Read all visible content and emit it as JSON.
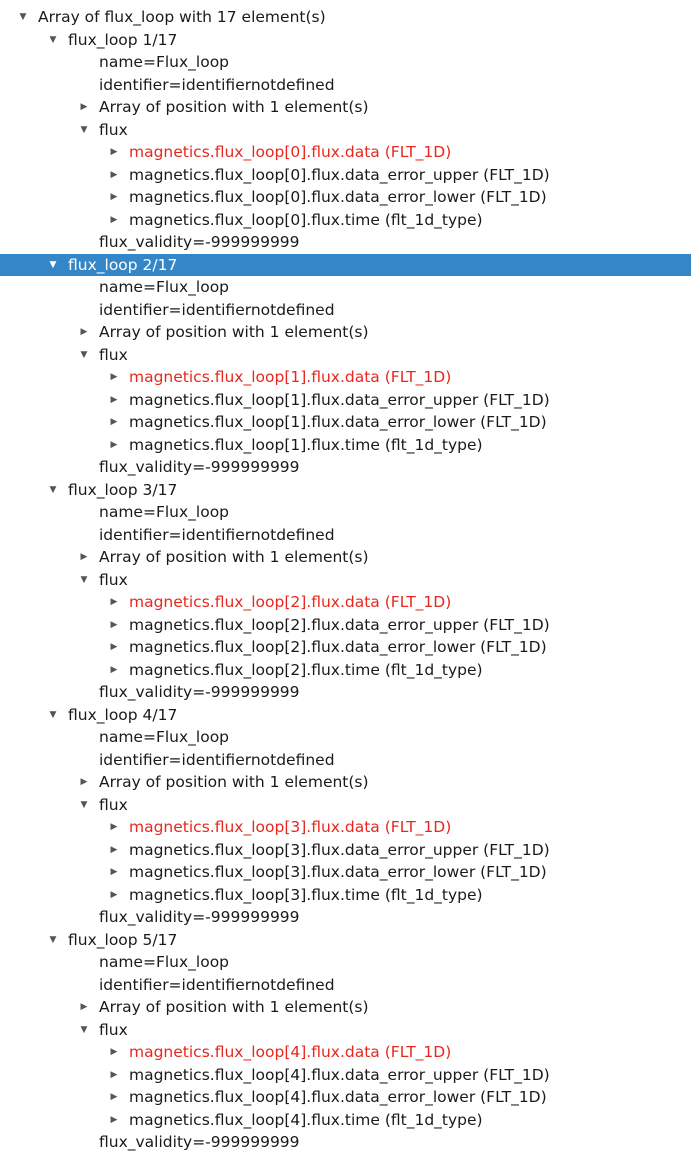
{
  "tree": {
    "root_label": "Array of flux_loop with 17 element(s)",
    "loops": [
      {
        "label": "flux_loop 1/17",
        "name": "name=Flux_loop",
        "identifier": "identifier=identifiernotdefined",
        "position": "Array of position with 1 element(s)",
        "flux_label": "flux",
        "data": "magnetics.flux_loop[0].flux.data (FLT_1D)",
        "data_error_upper": "magnetics.flux_loop[0].flux.data_error_upper (FLT_1D)",
        "data_error_lower": "magnetics.flux_loop[0].flux.data_error_lower (FLT_1D)",
        "time": "magnetics.flux_loop[0].flux.time (flt_1d_type)",
        "validity": "flux_validity=-999999999"
      },
      {
        "label": "flux_loop 2/17",
        "name": "name=Flux_loop",
        "identifier": "identifier=identifiernotdefined",
        "position": "Array of position with 1 element(s)",
        "flux_label": "flux",
        "data": "magnetics.flux_loop[1].flux.data (FLT_1D)",
        "data_error_upper": "magnetics.flux_loop[1].flux.data_error_upper (FLT_1D)",
        "data_error_lower": "magnetics.flux_loop[1].flux.data_error_lower (FLT_1D)",
        "time": "magnetics.flux_loop[1].flux.time (flt_1d_type)",
        "validity": "flux_validity=-999999999"
      },
      {
        "label": "flux_loop 3/17",
        "name": "name=Flux_loop",
        "identifier": "identifier=identifiernotdefined",
        "position": "Array of position with 1 element(s)",
        "flux_label": "flux",
        "data": "magnetics.flux_loop[2].flux.data (FLT_1D)",
        "data_error_upper": "magnetics.flux_loop[2].flux.data_error_upper (FLT_1D)",
        "data_error_lower": "magnetics.flux_loop[2].flux.data_error_lower (FLT_1D)",
        "time": "magnetics.flux_loop[2].flux.time (flt_1d_type)",
        "validity": "flux_validity=-999999999"
      },
      {
        "label": "flux_loop 4/17",
        "name": "name=Flux_loop",
        "identifier": "identifier=identifiernotdefined",
        "position": "Array of position with 1 element(s)",
        "flux_label": "flux",
        "data": "magnetics.flux_loop[3].flux.data (FLT_1D)",
        "data_error_upper": "magnetics.flux_loop[3].flux.data_error_upper (FLT_1D)",
        "data_error_lower": "magnetics.flux_loop[3].flux.data_error_lower (FLT_1D)",
        "time": "magnetics.flux_loop[3].flux.time (flt_1d_type)",
        "validity": "flux_validity=-999999999"
      },
      {
        "label": "flux_loop 5/17",
        "name": "name=Flux_loop",
        "identifier": "identifier=identifiernotdefined",
        "position": "Array of position with 1 element(s)",
        "flux_label": "flux",
        "data": "magnetics.flux_loop[4].flux.data (FLT_1D)",
        "data_error_upper": "magnetics.flux_loop[4].flux.data_error_upper (FLT_1D)",
        "data_error_lower": "magnetics.flux_loop[4].flux.data_error_lower (FLT_1D)",
        "time": "magnetics.flux_loop[4].flux.time (flt_1d_type)",
        "validity": "flux_validity=-999999999"
      }
    ],
    "selected_loop_index": 1,
    "colors": {
      "selection": "#3586c7",
      "highlight_text": "#e8281e"
    },
    "icons": {
      "expanded": "chevron-down-icon",
      "collapsed": "chevron-right-icon"
    }
  }
}
